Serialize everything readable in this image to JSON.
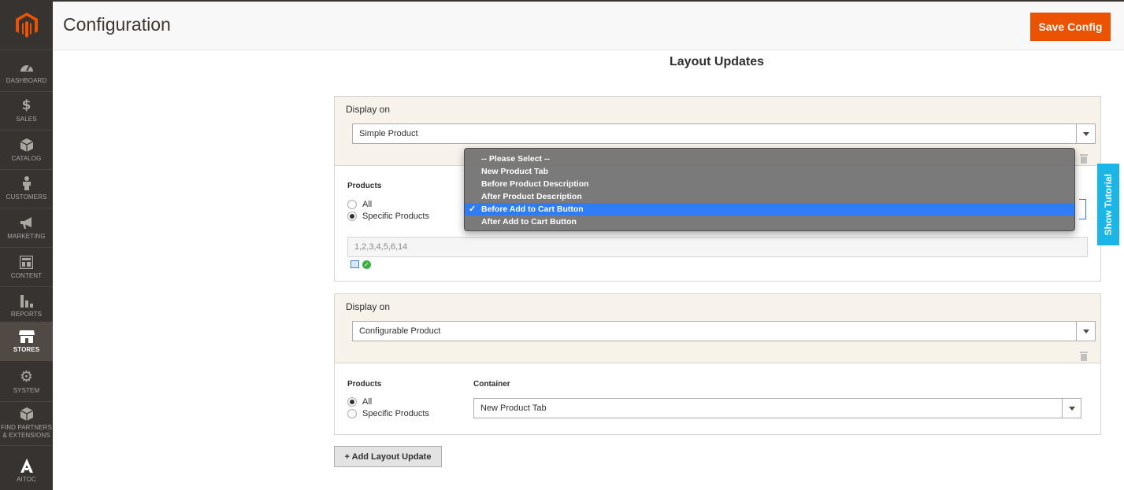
{
  "header": {
    "title": "Configuration",
    "save_label": "Save Config"
  },
  "sidebar": {
    "items": [
      {
        "label": "DASHBOARD",
        "icon": "dashboard-icon"
      },
      {
        "label": "SALES",
        "icon": "dollar-icon"
      },
      {
        "label": "CATALOG",
        "icon": "box-icon"
      },
      {
        "label": "CUSTOMERS",
        "icon": "person-icon"
      },
      {
        "label": "MARKETING",
        "icon": "megaphone-icon"
      },
      {
        "label": "CONTENT",
        "icon": "layout-icon"
      },
      {
        "label": "REPORTS",
        "icon": "bar-chart-icon"
      },
      {
        "label": "STORES",
        "icon": "store-icon",
        "active": true
      },
      {
        "label": "SYSTEM",
        "icon": "gear-icon"
      },
      {
        "label": "FIND PARTNERS & EXTENSIONS",
        "icon": "partners-box-icon"
      },
      {
        "label": "AITOC",
        "icon": "aitoc-icon"
      }
    ]
  },
  "section": {
    "title": "Layout Updates"
  },
  "updates": [
    {
      "display_on_label": "Display on",
      "display_on_value": "Simple Product",
      "products_label": "Products",
      "radio_all": "All",
      "radio_specific": "Specific Products",
      "selected_radio": "Specific Products",
      "product_ids": "1,2,3,4,5,6,14"
    },
    {
      "display_on_label": "Display on",
      "display_on_value": "Configurable Product",
      "products_label": "Products",
      "radio_all": "All",
      "radio_specific": "Specific Products",
      "selected_radio": "All",
      "container_label": "Container",
      "container_value": "New Product Tab"
    }
  ],
  "dropdown": {
    "options": [
      "-- Please Select --",
      "New Product Tab",
      "Before Product Description",
      "After Product Description",
      "Before Add to Cart Button",
      "After Add to Cart Button"
    ],
    "selected": "Before Add to Cart Button"
  },
  "add_button": {
    "label": "+ Add Layout Update"
  },
  "tutorial": {
    "label": "Show Tutorial"
  },
  "colors": {
    "accent": "#eb5202",
    "sidebar": "#373330",
    "selection": "#2f7cf6",
    "tutorial": "#1ab6e8"
  }
}
